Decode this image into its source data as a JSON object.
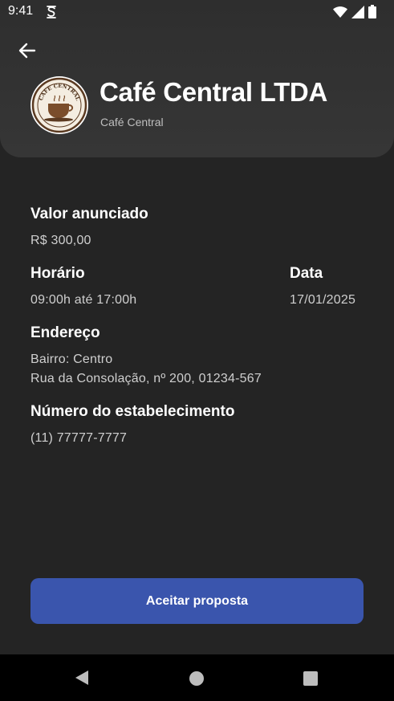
{
  "status_bar": {
    "time": "9:41"
  },
  "header": {
    "title": "Café Central LTDA",
    "subtitle": "Café Central",
    "logo_text": "CAFE CENTRAL"
  },
  "details": {
    "value_label": "Valor anunciado",
    "value": "R$ 300,00",
    "schedule_label": "Horário",
    "schedule": "09:00h até 17:00h",
    "date_label": "Data",
    "date": "17/01/2025",
    "address_label": "Endereço",
    "address_line1": "Bairro: Centro",
    "address_line2": "Rua da Consolação, nº 200, 01234-567",
    "phone_label": "Número do estabelecimento",
    "phone": "(11) 77777-7777"
  },
  "actions": {
    "accept_label": "Aceitar proposta"
  },
  "icons": {
    "back": "arrow-left-icon",
    "wifi": "wifi-icon",
    "signal": "cell-signal-icon",
    "battery": "battery-icon",
    "nav_back": "triangle-back-icon",
    "nav_home": "circle-home-icon",
    "nav_recents": "square-recents-icon"
  },
  "colors": {
    "background": "#242424",
    "header": "#333333",
    "accent_button": "#3a55ad"
  }
}
